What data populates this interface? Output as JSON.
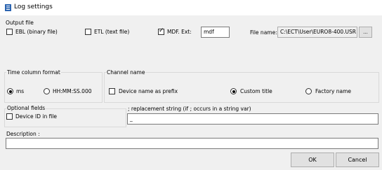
{
  "window": {
    "title": "Log settings",
    "icon": "log-settings-icon",
    "accent": "#2b64b0"
  },
  "output_file": {
    "group_label": "Output file",
    "ebl_label": "EBL (binary file)",
    "ebl_checked": false,
    "etl_label": "ETL (text file)",
    "etl_checked": false,
    "mdf_label": "MDF. Ext:",
    "mdf_checked": true,
    "mdf_ext_value": "mdf",
    "file_name_label": "File name:",
    "file_name_value": "C:\\ECT\\User\\EURO8-400.USR",
    "browse_label": "..."
  },
  "time_column": {
    "group_label": "Time column format",
    "ms_label": "ms",
    "ms_selected": true,
    "hms_label": "HH:MM:SS.000",
    "hms_selected": false
  },
  "channel_name": {
    "group_label": "Channel name",
    "device_prefix_label": "Device name as prefix",
    "device_prefix_checked": false,
    "custom_title_label": "Custom title",
    "custom_title_selected": true,
    "factory_name_label": "Factory name",
    "factory_name_selected": false
  },
  "optional_fields": {
    "group_label": "Optional fields",
    "device_id_label": "Device ID in file",
    "device_id_checked": false
  },
  "replacement": {
    "label": "; replacement string (if ; occurs in a string var)",
    "value": "_"
  },
  "description": {
    "label": "Description :",
    "value": ""
  },
  "buttons": {
    "ok": "OK",
    "cancel": "Cancel"
  }
}
